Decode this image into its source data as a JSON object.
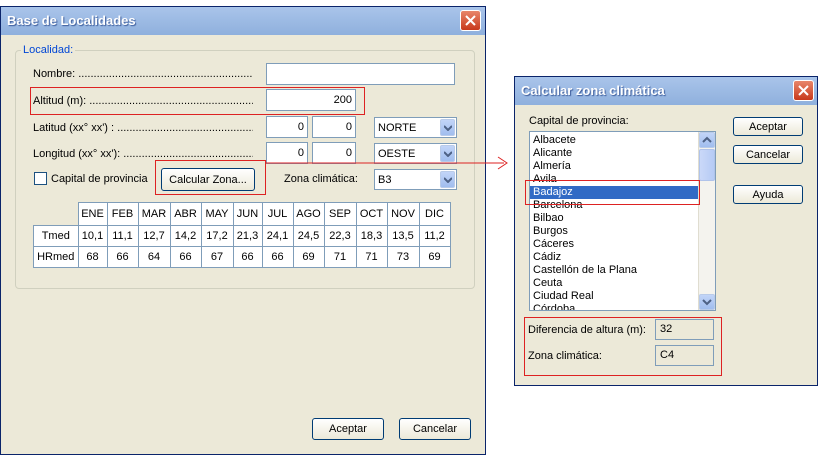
{
  "main": {
    "title": "Base de Localidades",
    "group_label": "Localidad:",
    "nombre_label": "Nombre: ............................................................",
    "nombre_value": "",
    "altitud_label": "Altitud (m): ........................................................",
    "altitud_value": "200",
    "latitud_label": "Latitud (xx° xx') : ..............................................",
    "latitud_deg": "0",
    "latitud_min": "0",
    "latitud_dir": "NORTE",
    "longitud_label": "Longitud (xx° xx'): ..............................................",
    "longitud_deg": "0",
    "longitud_min": "0",
    "longitud_dir": "OESTE",
    "capital_label": "Capital de provincia",
    "calc_button": "Calcular Zona...",
    "zona_label": "Zona climática:",
    "zona_value": "B3",
    "months": [
      "ENE",
      "FEB",
      "MAR",
      "ABR",
      "MAY",
      "JUN",
      "JUL",
      "AGO",
      "SEP",
      "OCT",
      "NOV",
      "DIC"
    ],
    "tmed_label": "Tmed",
    "tmed": [
      "10,1",
      "11,1",
      "12,7",
      "14,2",
      "17,2",
      "21,3",
      "24,1",
      "24,5",
      "22,3",
      "18,3",
      "13,5",
      "11,2"
    ],
    "hrmed_label": "HRmed",
    "hrmed": [
      "68",
      "66",
      "64",
      "66",
      "67",
      "66",
      "66",
      "69",
      "71",
      "71",
      "73",
      "69"
    ],
    "ok_button": "Aceptar",
    "cancel_button": "Cancelar"
  },
  "dialog": {
    "title": "Calcular zona climática",
    "list_label": "Capital de provincia:",
    "items": [
      "Albacete",
      "Alicante",
      "Almería",
      "Avila",
      "Badajoz",
      "Barcelona",
      "Bilbao",
      "Burgos",
      "Cáceres",
      "Cádiz",
      "Castellón de la Plana",
      "Ceuta",
      "Ciudad Real",
      "Córdoba"
    ],
    "selected_index": 4,
    "ok_button": "Aceptar",
    "cancel_button": "Cancelar",
    "help_button": "Ayuda",
    "diff_label": "Diferencia de altura (m):",
    "diff_value": "32",
    "zona_label": "Zona climática:",
    "zona_value": "C4"
  },
  "colors": {
    "annotation": "#dd2222",
    "selection": "#316ac5"
  }
}
